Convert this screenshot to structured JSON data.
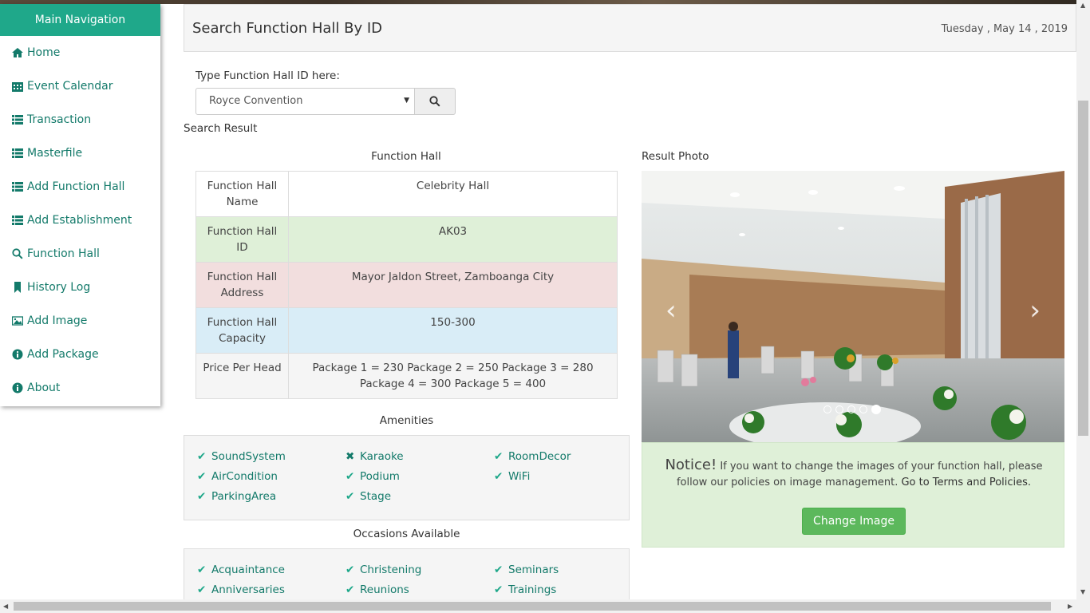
{
  "sidebar": {
    "header": "Main Navigation",
    "items": [
      {
        "label": "Home",
        "icon": "home-icon"
      },
      {
        "label": "Event Calendar",
        "icon": "calendar-icon"
      },
      {
        "label": "Transaction",
        "icon": "list-icon"
      },
      {
        "label": "Masterfile",
        "icon": "list-icon"
      },
      {
        "label": "Add Function Hall",
        "icon": "list-icon"
      },
      {
        "label": "Add Establishment",
        "icon": "list-icon"
      },
      {
        "label": "Function Hall",
        "icon": "search-icon"
      },
      {
        "label": "History Log",
        "icon": "bookmark-icon"
      },
      {
        "label": "Add Image",
        "icon": "picture-icon"
      },
      {
        "label": "Add Package",
        "icon": "info-icon"
      },
      {
        "label": "About",
        "icon": "info-icon"
      }
    ]
  },
  "header": {
    "title": "Search Function Hall By ID",
    "date": "Tuesday , May 14 , 2019"
  },
  "search": {
    "label": "Type Function Hall ID here:",
    "selected": "Royce Convention",
    "result_label": "Search Result"
  },
  "function_hall": {
    "title": "Function Hall",
    "rows": [
      {
        "key": "Function Hall Name",
        "value": "Celebrity Hall"
      },
      {
        "key": "Function Hall ID",
        "value": "AK03"
      },
      {
        "key": "Function Hall Address",
        "value": "Mayor Jaldon Street, Zamboanga City"
      },
      {
        "key": "Function Hall Capacity",
        "value": "150-300"
      },
      {
        "key": "Price Per Head",
        "value": "Package 1 = 230 Package 2 = 250 Package 3 = 280 Package 4 = 300 Package 5 = 400"
      }
    ]
  },
  "amenities": {
    "title": "Amenities",
    "items": [
      {
        "label": "SoundSystem",
        "available": true
      },
      {
        "label": "Karaoke",
        "available": false
      },
      {
        "label": "RoomDecor",
        "available": true
      },
      {
        "label": "AirCondition",
        "available": true
      },
      {
        "label": "Podium",
        "available": true
      },
      {
        "label": "WiFi",
        "available": true
      },
      {
        "label": "ParkingArea",
        "available": true
      },
      {
        "label": "Stage",
        "available": true
      }
    ]
  },
  "occasions": {
    "title": "Occasions Available",
    "items": [
      {
        "label": "Acquaintance",
        "available": true
      },
      {
        "label": "Christening",
        "available": true
      },
      {
        "label": "Seminars",
        "available": true
      },
      {
        "label": "Anniversaries",
        "available": true
      },
      {
        "label": "Reunions",
        "available": true
      },
      {
        "label": "Trainings",
        "available": true
      }
    ]
  },
  "photo": {
    "title": "Result Photo",
    "carousel_count": 5,
    "active_index": 4
  },
  "notice": {
    "heading": "Notice!",
    "text": " If you want to change the images of your function hall, please follow our policies on image management. ",
    "link": "Go to Terms and Policies.",
    "button": "Change Image"
  },
  "colors": {
    "accent": "#1fa88a",
    "link": "#137a6a",
    "success": "#5cb85c"
  }
}
